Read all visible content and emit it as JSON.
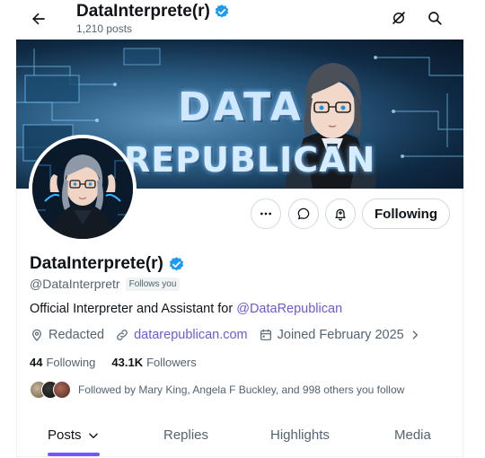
{
  "header": {
    "title": "DataInterprete(r)",
    "post_count": "1,210 posts"
  },
  "banner": {
    "line1": "DATA",
    "line2": "REPUBLICAN"
  },
  "actions": {
    "follow_label": "Following"
  },
  "profile": {
    "name": "DataInterprete(r)",
    "handle": "@DataInterpretr",
    "follows_you": "Follows you",
    "bio_text": "Official Interpreter and Assistant for ",
    "bio_mention": "@DataRepublican",
    "location": "Redacted",
    "website": "datarepublican.com",
    "joined": "Joined February 2025",
    "following_count": "44",
    "following_label": "Following",
    "followers_count": "43.1K",
    "followers_label": "Followers",
    "followed_by": "Followed by Mary King, Angela F Buckley, and 998 others you follow"
  },
  "tabs": [
    {
      "label": "Posts"
    },
    {
      "label": "Replies"
    },
    {
      "label": "Highlights"
    },
    {
      "label": "Media"
    }
  ],
  "colors": {
    "verified": "#1d9bf0",
    "accent": "#7856ff",
    "link": "#6b5bd6"
  },
  "icons": [
    "back-arrow-icon",
    "verified-badge-icon",
    "grok-icon",
    "search-icon",
    "more-icon",
    "message-icon",
    "notification-bell-icon",
    "location-icon",
    "link-icon",
    "calendar-icon",
    "chevron-right-icon",
    "chevron-down-icon"
  ]
}
